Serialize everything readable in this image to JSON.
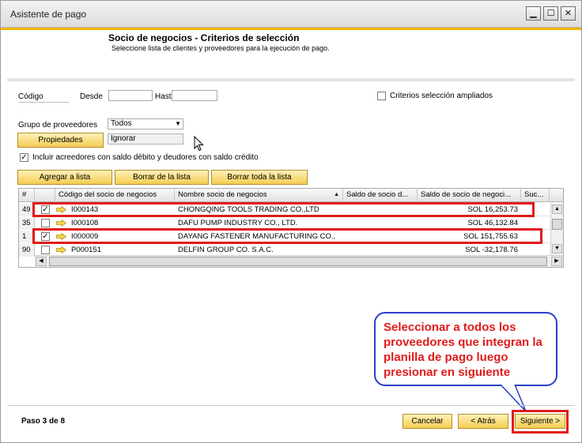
{
  "window": {
    "title": "Asistente de pago",
    "minimize_glyph": "▁",
    "maximize_glyph": "☐",
    "close_glyph": "✕"
  },
  "header": {
    "title": "Socio de negocios - Criterios de selección",
    "subtitle": "Seleccione lista de clientes y proveedores para la ejecución de pago."
  },
  "form": {
    "codigo_label": "Código",
    "desde_label": "Desde",
    "desde_value": "",
    "hasta_label": "Hast",
    "hasta_value": "",
    "criterios_label": "Criterios selección ampliados",
    "criterios_checked": false,
    "grupo_label": "Grupo de proveedores",
    "grupo_value": "Todos",
    "propiedades_label": "Propiedades",
    "ignorar_value": "Ignorar",
    "incluir_label": "Incluir acreedores con saldo débito y deudores con saldo crédito",
    "incluir_checked": true,
    "check_glyph": "✓"
  },
  "actions": {
    "agregar": "Agregar a lista",
    "borrar": "Borrar de la lista",
    "borrar_toda": "Borrar toda la lista"
  },
  "grid": {
    "columns": [
      "#",
      "",
      "Código del socio de negocios",
      "Nombre socio de negocios",
      "Saldo de socio d...",
      "Saldo de socio de negoci...",
      "Suc..."
    ],
    "sort_glyph": "▲",
    "rows": [
      {
        "num": "49",
        "checked": true,
        "code": "I000143",
        "name": "CHONGQING TOOLS TRADING CO.,LTD",
        "saldo1": "",
        "saldo2": "SOL 16,253.73"
      },
      {
        "num": "35",
        "checked": false,
        "code": "I000108",
        "name": "DAFU PUMP INDUSTRY CO., LTD.",
        "saldo1": "",
        "saldo2": "SOL 46,132.84"
      },
      {
        "num": "1",
        "checked": true,
        "code": "I000009",
        "name": "DAYANG FASTENER MANUFACTURING CO.,",
        "saldo1": "",
        "saldo2": "SOL 151,755.63"
      },
      {
        "num": "90",
        "checked": false,
        "code": "P000151",
        "name": "DELFIN GROUP CO. S.A.C.",
        "saldo1": "",
        "saldo2": "SOL -32,178.76"
      }
    ]
  },
  "callout": {
    "text": "Seleccionar a todos los proveedores que integran la planilla de pago luego presionar en siguiente"
  },
  "footer": {
    "step": "Paso 3 de 8",
    "cancel": "Cancelar",
    "back": "< Atrás",
    "next": "Siguiente >"
  },
  "colors": {
    "accent": "#f0b400",
    "highlight": "#e01b1b",
    "callout_border": "#2940c9"
  }
}
